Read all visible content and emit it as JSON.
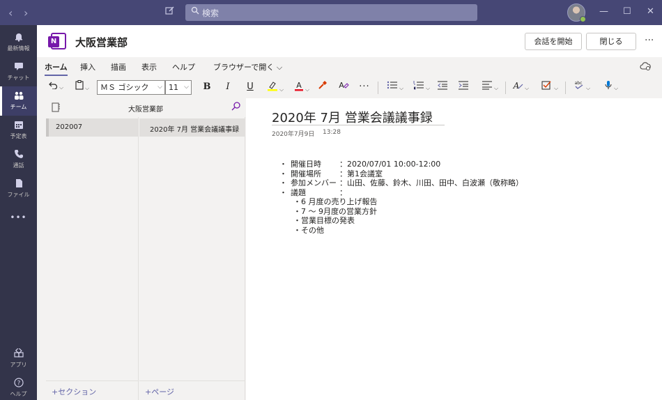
{
  "titlebar": {
    "back_glyph": "‹",
    "forward_glyph": "›",
    "compose_icon": "compose-icon",
    "search_placeholder": "検索",
    "minimize": "—",
    "maximize": "☐",
    "close": "✕"
  },
  "rail": {
    "items": [
      {
        "label": "最新情報",
        "icon": "bell-icon",
        "glyph": "🔔"
      },
      {
        "label": "チャット",
        "icon": "chat-icon",
        "glyph": "▤"
      },
      {
        "label": "チーム",
        "icon": "teams-icon",
        "glyph": "⛭"
      },
      {
        "label": "予定表",
        "icon": "calendar-icon",
        "glyph": "▦"
      },
      {
        "label": "通話",
        "icon": "phone-icon",
        "glyph": "✆"
      },
      {
        "label": "ファイル",
        "icon": "file-icon",
        "glyph": "▮"
      },
      {
        "label": "",
        "icon": "more-icon",
        "glyph": "•••"
      },
      {
        "label": "アプリ",
        "icon": "apps-icon",
        "glyph": "⊞"
      },
      {
        "label": "ヘルプ",
        "icon": "help-icon",
        "glyph": "?"
      }
    ]
  },
  "header": {
    "title": "大阪営業部",
    "start_conversation": "会話を開始",
    "close": "閉じる",
    "more": "···"
  },
  "ribbon": {
    "tabs": [
      "ホーム",
      "挿入",
      "描画",
      "表示",
      "ヘルプ",
      "ブラウザーで開く ⌵"
    ],
    "font_name": "ＭＳ ゴシック",
    "font_size": "11"
  },
  "notebook": {
    "title": "大阪営業部",
    "sections": [
      "202007"
    ],
    "pages": [
      "2020年 7月 営業会議議事録"
    ],
    "add_section": "+セクション",
    "add_page": "+ページ"
  },
  "page": {
    "title": "2020年 7月 営業会議議事録",
    "date": "2020年7月9日",
    "time": "13:28",
    "items": [
      {
        "bullet": "・",
        "key": "開催日時",
        "value": "：2020/07/01 10:00-12:00"
      },
      {
        "bullet": "・",
        "key": "開催場所",
        "value": "：第1会議室"
      },
      {
        "bullet": "・",
        "key": "参加メンバー",
        "value": "：山田、佐藤、鈴木、川田、田中、白波瀬（敬称略）"
      },
      {
        "bullet": "・",
        "key": "議題",
        "value": "："
      }
    ],
    "agenda": [
      "・6 月度の売り上げ報告",
      "・7 ～ 9月度の営業方針",
      "・営業目標の発表",
      "・その他"
    ]
  },
  "colors": {
    "titlebar": "#464775",
    "rail": "#33344a",
    "accent": "#6264a7",
    "onenote": "#7719aa",
    "highlight": "#ffff00",
    "font_color": "#e81123"
  }
}
